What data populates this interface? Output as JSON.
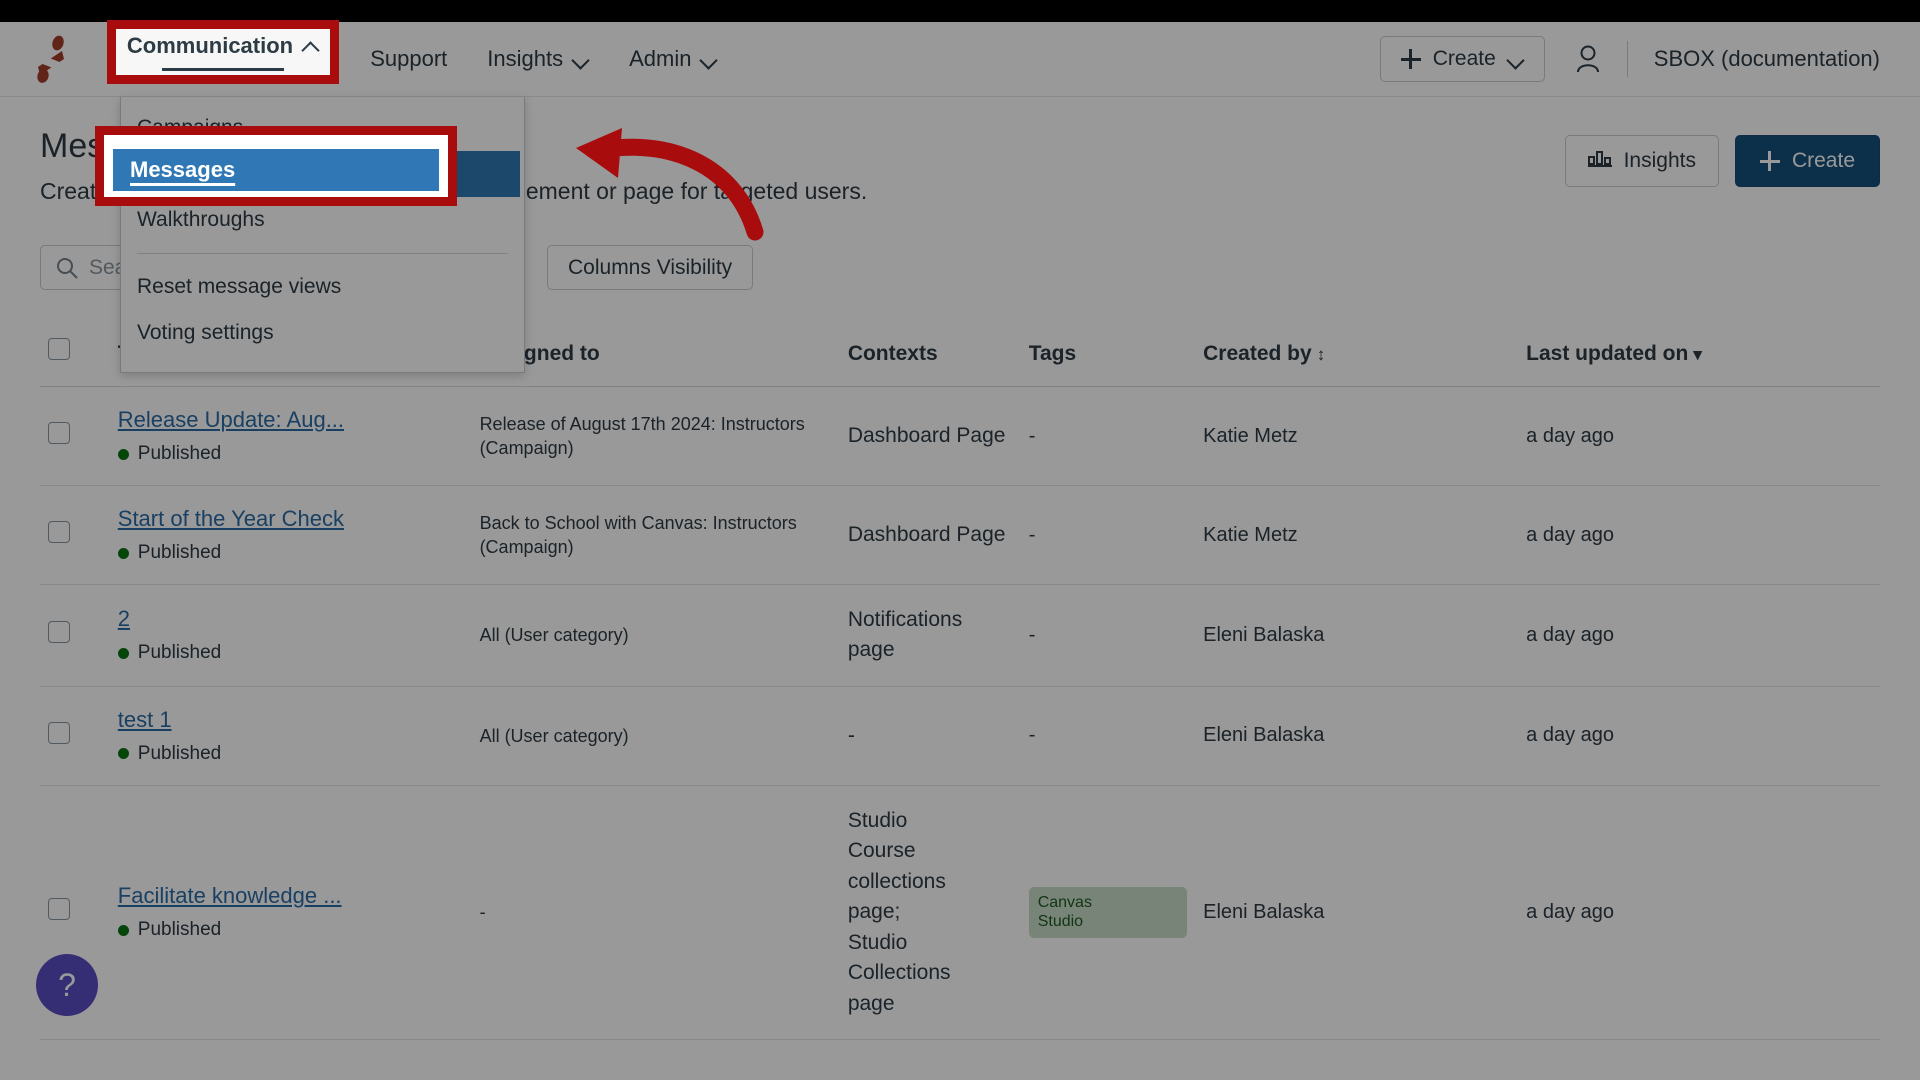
{
  "topnav": {
    "logo": "impact-logo",
    "items": [
      {
        "label": "Communication",
        "caret": "chevron-up-icon",
        "active": true
      },
      {
        "label": "Support",
        "caret": "",
        "active": false
      },
      {
        "label": "Insights",
        "caret": "chevron-down-icon",
        "active": false
      },
      {
        "label": "Admin",
        "caret": "chevron-down-icon",
        "active": false
      }
    ],
    "create_label": "Create",
    "create_caret": "chevron-down-icon",
    "user_icon": "user-icon",
    "account": "SBOX (documentation)"
  },
  "dropdown": {
    "items": [
      {
        "label": "Campaigns",
        "selected": false
      },
      {
        "label": "Messages",
        "selected": true
      },
      {
        "label": "Walkthroughs",
        "selected": false
      },
      {
        "label": "Reset message views",
        "selected": false
      },
      {
        "label": "Voting settings",
        "selected": false
      }
    ]
  },
  "page": {
    "title": "Messages",
    "subtitle": "Create a message to be shown on a selected element or page for targeted users.",
    "insights_label": "Insights",
    "create_label": "Create"
  },
  "toolbar": {
    "search_placeholder": "Search",
    "search_value": "",
    "filter_icon": "filter-icon",
    "columns_label": "Columns Visibility"
  },
  "table": {
    "headers": [
      {
        "label": "",
        "sort": ""
      },
      {
        "label": "Title",
        "sort": "↕"
      },
      {
        "label": "Assigned to",
        "sort": ""
      },
      {
        "label": "Contexts",
        "sort": ""
      },
      {
        "label": "Tags",
        "sort": ""
      },
      {
        "label": "Created by",
        "sort": "↕"
      },
      {
        "label": "Last updated on",
        "sort": "▾"
      }
    ],
    "rows": [
      {
        "title": "Release Update: Aug...",
        "status": "Published",
        "assigned": "Release of August 17th 2024: Instructors (Campaign)",
        "contexts": "Dashboard Page",
        "tags": "-",
        "tag_chip": "",
        "created_by": "Katie Metz",
        "updated": "a day ago"
      },
      {
        "title": "Start of the Year Check",
        "status": "Published",
        "assigned": "Back to School with Canvas: Instructors (Campaign)",
        "contexts": "Dashboard Page",
        "tags": "-",
        "tag_chip": "",
        "created_by": "Katie Metz",
        "updated": "a day ago"
      },
      {
        "title": "2",
        "status": "Published",
        "assigned": "All (User category)",
        "contexts": "Notifications page",
        "tags": "-",
        "tag_chip": "",
        "created_by": "Eleni Balaska",
        "updated": "a day ago"
      },
      {
        "title": "test 1",
        "status": "Published",
        "assigned": "All (User category)",
        "contexts": "-",
        "tags": "-",
        "tag_chip": "",
        "created_by": "Eleni Balaska",
        "updated": "a day ago"
      },
      {
        "title": "Facilitate knowledge ...",
        "status": "Published",
        "assigned": "-",
        "contexts": "Studio Course collections page; Studio Collections page",
        "tags": "",
        "tag_chip": "Canvas Studio",
        "created_by": "Eleni Balaska",
        "updated": "a day ago"
      }
    ]
  },
  "help": {
    "icon": "question-mark-icon"
  },
  "annotations": {
    "highlight_nav": "Communication",
    "highlight_nav_caret": "chevron-up-icon",
    "highlight_item": "Messages",
    "arrow": "curved-arrow-pointing-left",
    "color": "#a80c0c"
  }
}
